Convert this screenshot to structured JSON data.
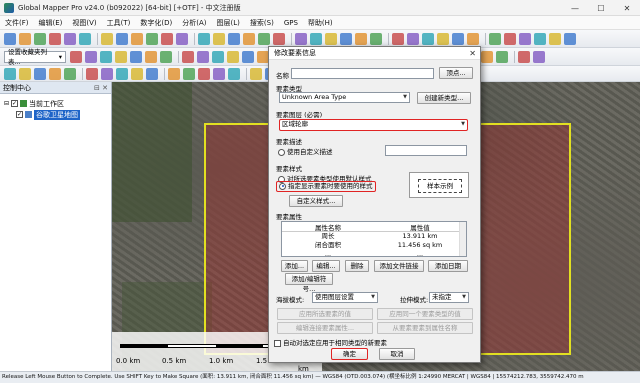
{
  "window": {
    "title": "Global Mapper Pro v24.0 (b092022) [64-bit] [+OTF] - 中文注册版",
    "controls": [
      "—",
      "☐",
      "✕"
    ]
  },
  "menu": [
    "文件(F)",
    "编辑(E)",
    "视图(V)",
    "工具(T)",
    "数字化(D)",
    "分析(A)",
    "图层(L)",
    "搜索(S)",
    "GPS",
    "帮助(H)"
  ],
  "toolbar": {
    "favorites_dropdown": "设置收藏夹列表...",
    "colors": [
      "#2f6fc9",
      "#e08a1e",
      "#3d9b45",
      "#c43b3b",
      "#7a4fbf",
      "#1d9fb0",
      "#d6b21c"
    ]
  },
  "control_center": {
    "title": "控制中心",
    "pin": "⊟ ✕",
    "tree": {
      "group_label": "当前工作区",
      "layer_label": "谷歌卫星地图"
    }
  },
  "map": {
    "scale_labels": [
      "0.0 km",
      "0.5 km",
      "1.0 km",
      "1.5 km",
      "2.0 km"
    ]
  },
  "statusbar": {
    "text": "Release Left Mouse Button to Complete. Use SHIFT Key to Make Square (面积: 13.911 km, 闭合面积 11.456 sq km) — WGS84 (OTD.003.074) (横坐标比例 1:24990  MERCAT | WGS84 | 15574212.783, 3559742.470 m"
  },
  "dialog": {
    "title": "修改要素信息",
    "close": "✕",
    "name_label": "名称",
    "name_value": "",
    "vertex_button": "顶点...",
    "feature_type_label": "要素类型",
    "feature_type_value": "Unknown Area Type",
    "create_type_button": "创建新类型...",
    "layer_label": "要素图层 (必需)",
    "layer_value": "区域轮廓",
    "description_label": "要素描述",
    "custom_description_label": "使用自定义描述",
    "custom_description_value": "",
    "style_label": "要素样式",
    "style_option_default": "对所选要素类型使用默认样式",
    "style_option_custom": "指定显示要素时要使用的样式",
    "custom_style_button": "自定义样式...",
    "preview_text": "样本示例",
    "attributes_label": "要素属性",
    "attr_columns": [
      "属性名称",
      "属性值"
    ],
    "attr_rows": [
      {
        "name": "周长",
        "value": "13.911 km"
      },
      {
        "name": "闭合面积",
        "value": "11.456 sq km"
      },
      {
        "name": "...",
        "value": "..."
      }
    ],
    "attr_buttons": [
      "添加...",
      "编辑...",
      "删除",
      "添加文件链接",
      "添加日期"
    ],
    "add_link_button": "添加/编辑符号...",
    "hatch_label": "海拔模式:",
    "hatch_value": "使用图层设置",
    "clamp_label": "拉伸模式:",
    "clamp_value": "未指定",
    "apply_buttons": [
      "应用所选要素的值",
      "应用同一个要素类型的值",
      "编辑连接要素属性...",
      "从要素要素到属性名称"
    ],
    "auto_apply_label": "自动对选定应用于相同类型的新要素",
    "ok_button": "确定",
    "cancel_button": "取消"
  }
}
